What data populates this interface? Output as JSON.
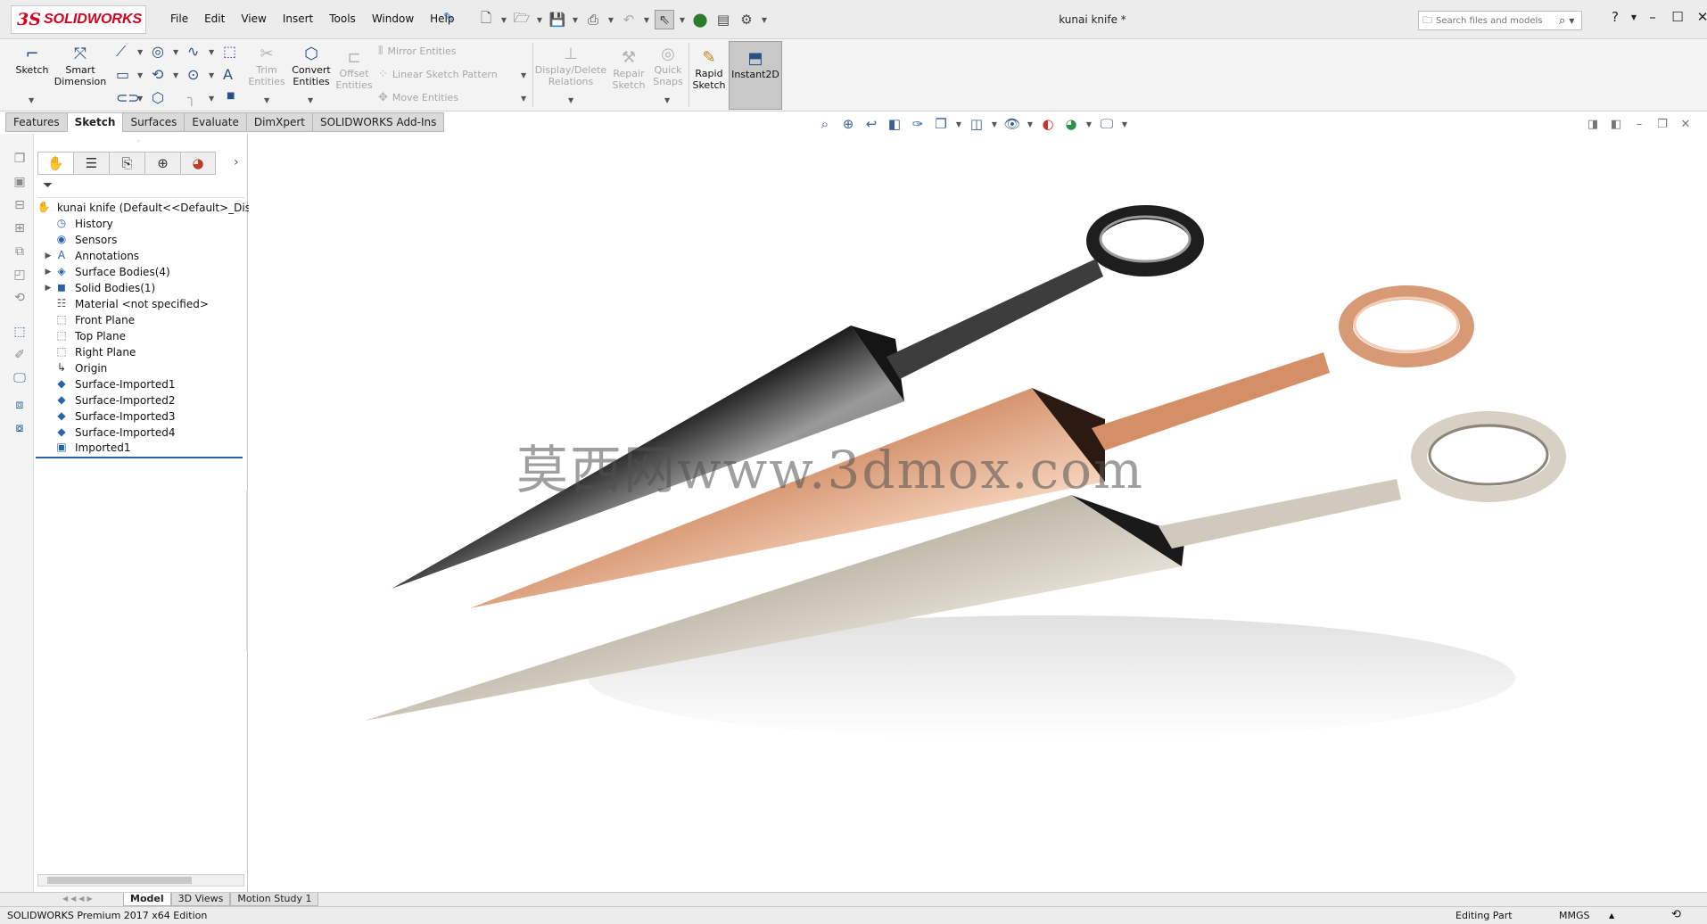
{
  "app": {
    "logo_ds": "3S",
    "logo_name": "SOLIDWORKS",
    "document_title": "kunai knife *"
  },
  "menu": [
    "File",
    "Edit",
    "View",
    "Insert",
    "Tools",
    "Window",
    "Help"
  ],
  "search": {
    "placeholder": "Search files and models"
  },
  "ribbon": {
    "sketch": "Sketch",
    "smart_dimension_1": "Smart",
    "smart_dimension_2": "Dimension",
    "trim_1": "Trim",
    "trim_2": "Entities",
    "convert_1": "Convert",
    "convert_2": "Entities",
    "offset_1": "Offset",
    "offset_2": "Entities",
    "mirror": "Mirror Entities",
    "linear_pattern": "Linear Sketch Pattern",
    "move": "Move Entities",
    "display_delete_1": "Display/Delete",
    "display_delete_2": "Relations",
    "repair_1": "Repair",
    "repair_2": "Sketch",
    "quick_snaps_1": "Quick",
    "quick_snaps_2": "Snaps",
    "rapid_sketch_1": "Rapid",
    "rapid_sketch_2": "Sketch",
    "instant2d": "Instant2D"
  },
  "command_tabs": [
    {
      "label": "Features",
      "active": false
    },
    {
      "label": "Sketch",
      "active": true
    },
    {
      "label": "Surfaces",
      "active": false
    },
    {
      "label": "Evaluate",
      "active": false
    },
    {
      "label": "DimXpert",
      "active": false
    },
    {
      "label": "SOLIDWORKS Add-Ins",
      "active": false
    }
  ],
  "feature_tree": {
    "root": "kunai knife  (Default<<Default>_Display",
    "items": [
      {
        "label": "History",
        "icon": "history-icon",
        "expandable": false
      },
      {
        "label": "Sensors",
        "icon": "sensor-icon",
        "expandable": false
      },
      {
        "label": "Annotations",
        "icon": "annotation-icon",
        "expandable": true
      },
      {
        "label": "Surface Bodies(4)",
        "icon": "surface-bodies-icon",
        "expandable": true
      },
      {
        "label": "Solid Bodies(1)",
        "icon": "solid-bodies-icon",
        "expandable": true
      },
      {
        "label": "Material <not specified>",
        "icon": "material-icon",
        "expandable": false
      },
      {
        "label": "Front Plane",
        "icon": "plane-icon",
        "expandable": false
      },
      {
        "label": "Top Plane",
        "icon": "plane-icon",
        "expandable": false
      },
      {
        "label": "Right Plane",
        "icon": "plane-icon",
        "expandable": false
      },
      {
        "label": "Origin",
        "icon": "origin-icon",
        "expandable": false
      },
      {
        "label": "Surface-Imported1",
        "icon": "surface-imported-icon",
        "expandable": false
      },
      {
        "label": "Surface-Imported2",
        "icon": "surface-imported-icon",
        "expandable": false
      },
      {
        "label": "Surface-Imported3",
        "icon": "surface-imported-icon",
        "expandable": false
      },
      {
        "label": "Surface-Imported4",
        "icon": "surface-imported-icon",
        "expandable": false
      },
      {
        "label": "Imported1",
        "icon": "imported-body-icon",
        "expandable": false
      }
    ]
  },
  "watermark": "莫西网www.3dmox.com",
  "bottom_tabs": [
    {
      "label": "Model",
      "active": true
    },
    {
      "label": "3D Views",
      "active": false
    },
    {
      "label": "Motion Study 1",
      "active": false
    }
  ],
  "status": {
    "edition": "SOLIDWORKS Premium 2017 x64 Edition",
    "mode": "Editing Part",
    "units": "MMGS"
  },
  "colors": {
    "brand": "#d6001c",
    "accent": "#2a63a8",
    "kunai_dark": "#2b2b2b",
    "kunai_copper": "#d9906a",
    "kunai_silver": "#cfcabb"
  }
}
